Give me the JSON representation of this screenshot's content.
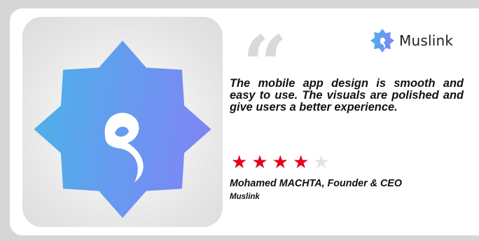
{
  "testimonial": {
    "quote": "The mobile app design is smooth and easy to use. The visuals are polished and give users a better experience.",
    "rating": 4,
    "rating_max": 5,
    "reviewer": "Mohamed MACHTA, Founder & CEO",
    "company": "Muslink"
  },
  "logo": {
    "wordmark": "Muslink",
    "icon": "muslink-star-icon"
  },
  "app_icon": {
    "icon": "muslink-app-icon",
    "colors": {
      "gradient_start": "#4bb3e8",
      "gradient_end": "#7c87f5"
    }
  },
  "colors": {
    "star_filled": "#e4001b",
    "star_empty": "#e3e3e3",
    "quote_mark": "#d9d9d9"
  }
}
